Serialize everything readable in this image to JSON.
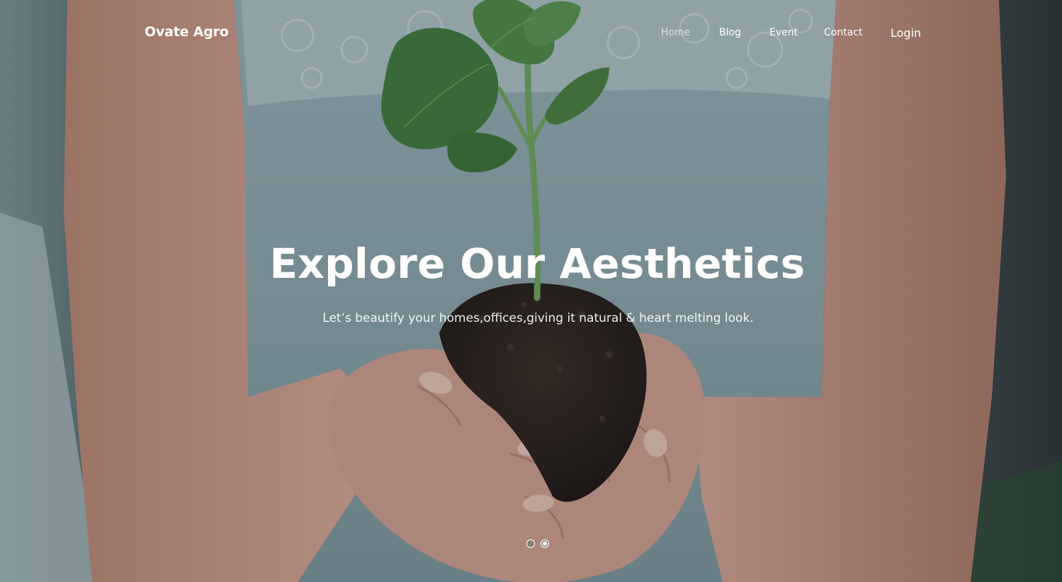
{
  "brand": {
    "name": "Ovate Agro"
  },
  "nav": {
    "items": [
      {
        "label": "Home",
        "active": true
      },
      {
        "label": "Blog",
        "active": false
      },
      {
        "label": "Event",
        "active": false
      },
      {
        "label": "Contact",
        "active": false
      }
    ],
    "login_label": "Login"
  },
  "hero": {
    "title": "Explore Our Aesthetics",
    "subtitle": "Let’s beautify your homes,offices,giving it natural & heart melting look.",
    "background": "woman in lace top holding seedling in soil",
    "slides_total": 2,
    "current_slide": 2
  },
  "colors": {
    "text": "#ffffff",
    "nav_active": "#b9c4c6",
    "shirt": "#8ea6ad",
    "skin": "#d9a99a",
    "soil": "#2e221d",
    "leaf": "#4e8a47"
  }
}
